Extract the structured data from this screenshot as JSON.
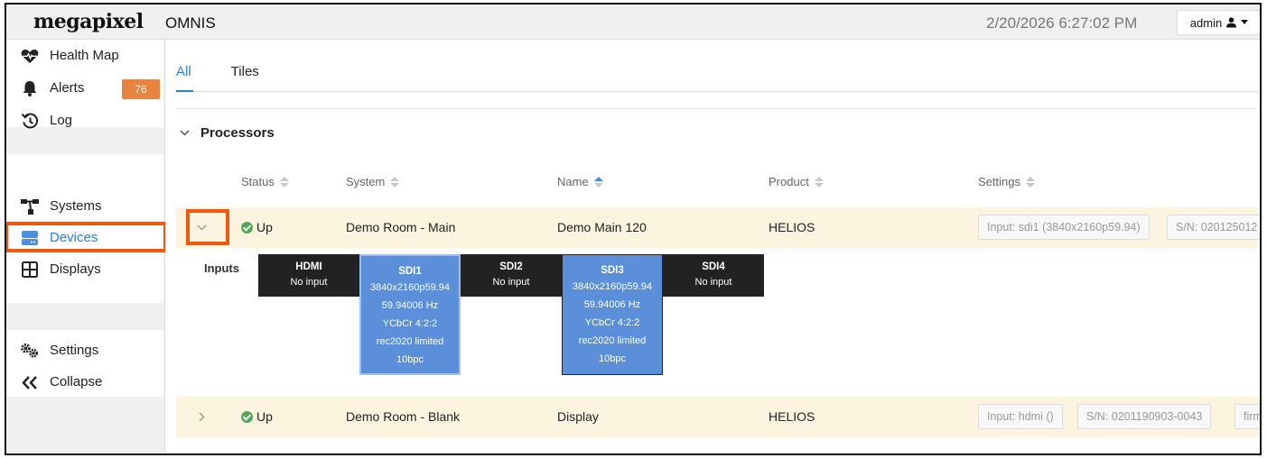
{
  "header": {
    "logo": "megapixel",
    "app_title": "OMNIS",
    "datetime": "2/20/2026 6:27:02 PM",
    "user": "admin"
  },
  "sidebar": {
    "items": [
      {
        "label": "Health Map",
        "icon": "heartbeat-icon"
      },
      {
        "label": "Alerts",
        "icon": "bell-icon",
        "badge": "76"
      },
      {
        "label": "Log",
        "icon": "history-icon"
      },
      {
        "label": "Systems",
        "icon": "hierarchy-icon"
      },
      {
        "label": "Devices",
        "icon": "server-icon",
        "active": true
      },
      {
        "label": "Displays",
        "icon": "grid-icon"
      },
      {
        "label": "Settings",
        "icon": "gears-icon"
      },
      {
        "label": "Collapse",
        "icon": "double-chevron-left-icon"
      }
    ]
  },
  "tabs": [
    {
      "label": "All",
      "active": true
    },
    {
      "label": "Tiles",
      "active": false
    }
  ],
  "section": {
    "title": "Processors"
  },
  "table": {
    "headers": [
      "Status",
      "System",
      "Name",
      "Product",
      "Settings"
    ],
    "rows": [
      {
        "status": "Up",
        "system": "Demo Room - Main",
        "name": "Demo Main 120",
        "product": "HELIOS",
        "settings": [
          "Input: sdi1 (3840x2160p59.94)",
          "S/N: 020125012"
        ],
        "expanded": true
      },
      {
        "status": "Up",
        "system": "Demo Room - Blank",
        "name": "Display",
        "product": "HELIOS",
        "settings": [
          "Input: hdmi ()",
          "S/N: 0201190903-0043",
          "firm"
        ],
        "expanded": false
      }
    ]
  },
  "inputs": {
    "label": "Inputs",
    "items": [
      {
        "name": "HDMI",
        "lines": [
          "No input"
        ],
        "active": false
      },
      {
        "name": "SDI1",
        "lines": [
          "3840x2160p59.94",
          "59.94006 Hz",
          "YCbCr 4:2:2",
          "rec2020 limited",
          "10bpc"
        ],
        "active": true
      },
      {
        "name": "SDI2",
        "lines": [
          "No input"
        ],
        "active": false
      },
      {
        "name": "SDI3",
        "lines": [
          "3840x2160p59.94",
          "59.94006 Hz",
          "YCbCr 4:2:2",
          "rec2020 limited",
          "10bpc"
        ],
        "active": true
      },
      {
        "name": "SDI4",
        "lines": [
          "No input"
        ],
        "active": false
      }
    ]
  },
  "colors": {
    "accent": "#2b7fd6",
    "badge": "#e8823f",
    "highlight": "#f0580f",
    "row_bg": "#fcf4de",
    "status_up": "#4caa55",
    "input_active": "#5c8fd9",
    "input_inactive": "#222222"
  }
}
